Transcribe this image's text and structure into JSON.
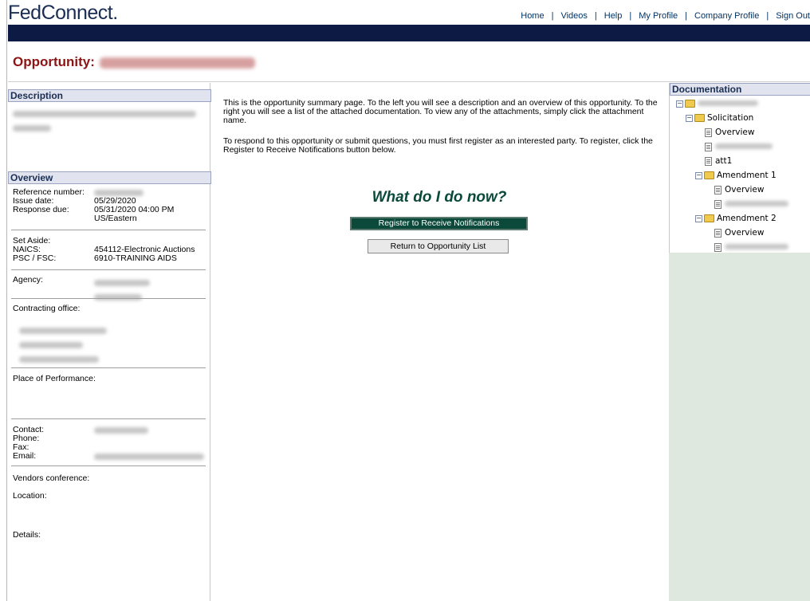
{
  "header": {
    "logo": "FedConnect.",
    "nav": [
      "Home",
      "Videos",
      "Help",
      "My Profile",
      "Company Profile",
      "Sign Out"
    ]
  },
  "opportunity": {
    "label": "Opportunity:"
  },
  "description": {
    "title": "Description"
  },
  "overview": {
    "title": "Overview",
    "reference_number_label": "Reference number:",
    "issue_date_label": "Issue date:",
    "issue_date": "05/29/2020",
    "response_due_label": "Response due:",
    "response_due": "05/31/2020 04:00 PM",
    "response_due_tz": "US/Eastern",
    "set_aside_label": "Set Aside:",
    "naics_label": "NAICS:",
    "naics": "454112-Electronic Auctions",
    "psc_label": "PSC / FSC:",
    "psc": "6910-TRAINING AIDS",
    "agency_label": "Agency:",
    "contracting_office_label": "Contracting office:",
    "place_of_performance_label": "Place of Performance:",
    "contact_label": "Contact:",
    "phone_label": "Phone:",
    "fax_label": "Fax:",
    "email_label": "Email:",
    "vendors_conference_label": "Vendors conference:",
    "location_label": "Location:",
    "details_label": "Details:"
  },
  "main": {
    "intro_1": "This is the opportunity summary page. To the left you will see a description and an overview of this opportunity. To the right you will see a list of the attached documentation. To view any of the attachments, simply click the attachment name.",
    "intro_2": "To respond to this opportunity or submit questions, you must first register as an interested party. To register, click the Register to Receive Notifications button below.",
    "heading": "What do I do now?",
    "register_button": "Register to Receive Notifications",
    "return_button": "Return to Opportunity List"
  },
  "documentation": {
    "title": "Documentation",
    "solicitation": "Solicitation",
    "overview_1": "Overview",
    "att1": "att1",
    "amendment_1": "Amendment 1",
    "overview_2": "Overview",
    "amendment_2": "Amendment 2",
    "overview_3": "Overview"
  }
}
